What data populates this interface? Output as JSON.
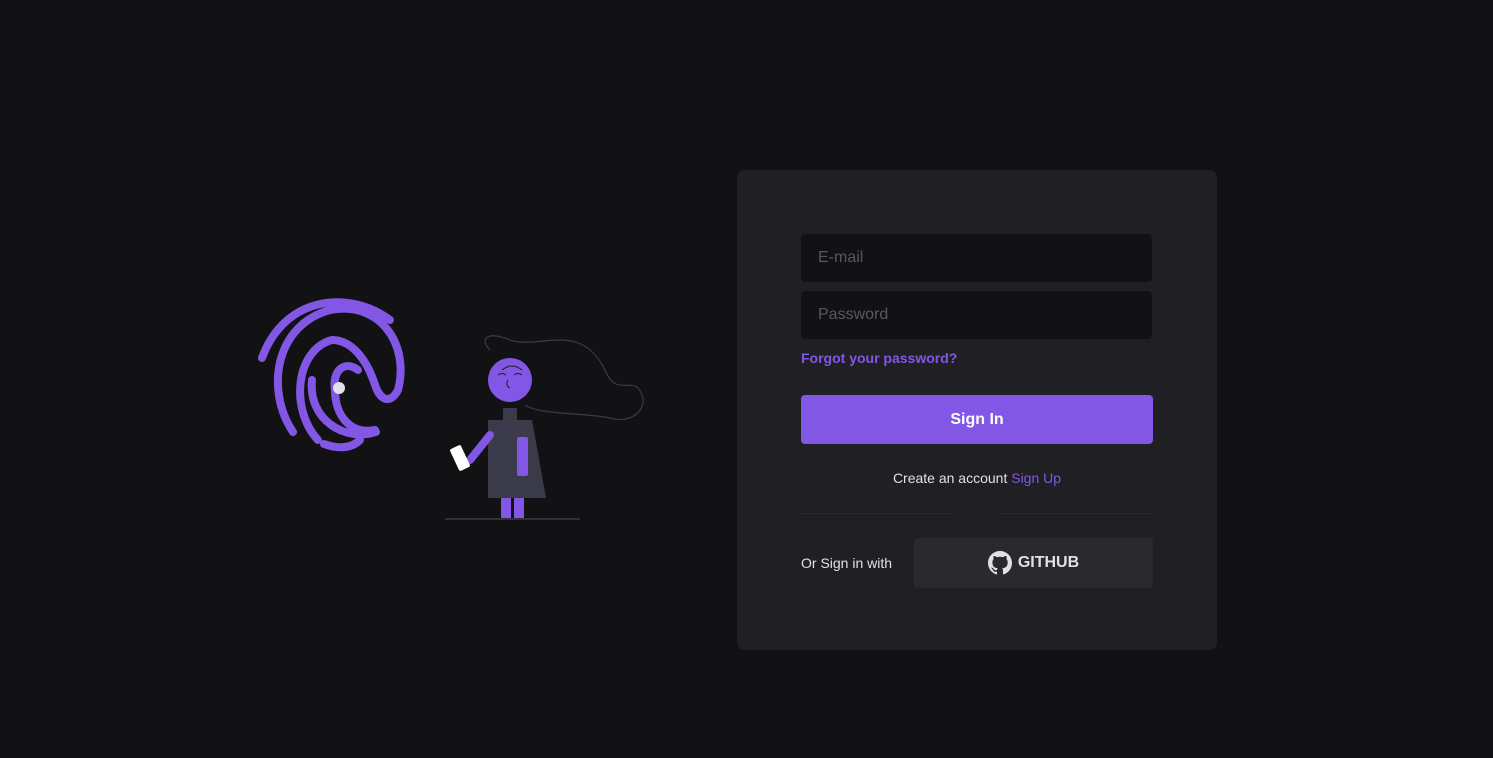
{
  "login": {
    "email_placeholder": "E-mail",
    "password_placeholder": "Password",
    "forgot_password": "Forgot your password?",
    "sign_in": "Sign In",
    "create_account_text": "Create an account",
    "sign_up": "Sign Up",
    "social_label": "Or Sign in with",
    "github_label": "GITHUB"
  },
  "icons": {
    "logo": "fingerprint-logo-icon",
    "github": "github-icon"
  },
  "colors": {
    "background": "#121214",
    "card": "#202024",
    "input": "#121214",
    "accent": "#8257e5",
    "text": "#e1e1e6",
    "placeholder": "#58585f",
    "secondary_button": "#29292e"
  }
}
